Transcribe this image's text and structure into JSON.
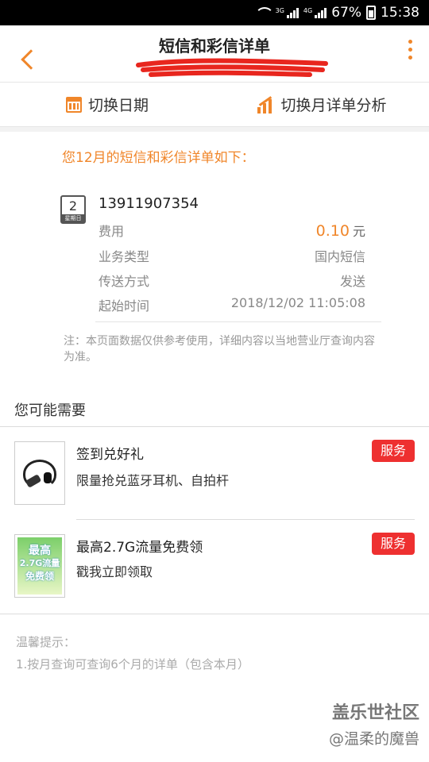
{
  "status_bar": {
    "battery": "67%",
    "time": "15:38",
    "network_1": "3G",
    "network_2": "4G"
  },
  "header": {
    "title": "短信和彩信详单",
    "back_icon": "chevron-left-icon",
    "menu_icon": "more-vertical-icon",
    "accent_color": "#f0862a"
  },
  "switchbar": {
    "date_label": "切换日期",
    "analysis_label": "切换月详单分析"
  },
  "details": {
    "lead": "您12月的短信和彩信详单如下：",
    "badge_day": "2",
    "badge_weekday": "星期日",
    "phone": "13911907354",
    "rows": [
      {
        "label": "费用",
        "value": "0.10",
        "unit": "元"
      },
      {
        "label": "业务类型",
        "value": "国内短信"
      },
      {
        "label": "传送方式",
        "value": "发送"
      },
      {
        "label": "起始时间",
        "value": "2018/12/02 11:05:08"
      }
    ],
    "note": "注：本页面数据仅供参考使用，详细内容以当地营业厅查询内容为准。"
  },
  "recommend": {
    "title": "您可能需要",
    "cards": [
      {
        "title": "签到兑好礼",
        "subtitle": "限量抢兑蓝牙耳机、自拍杆",
        "badge": "服务"
      },
      {
        "title": "最高2.7G流量免费领",
        "subtitle": "戳我立即领取",
        "badge": "服务",
        "thumb_line1": "最高",
        "thumb_line2": "2.7G流量",
        "thumb_line3": "免费领"
      }
    ]
  },
  "tips": {
    "title": "温馨提示：",
    "items": [
      "1.按月查询可查询6个月的详单（包含本月）"
    ]
  },
  "watermark": {
    "site": "盖乐世社区",
    "author": "@温柔的魔兽"
  }
}
